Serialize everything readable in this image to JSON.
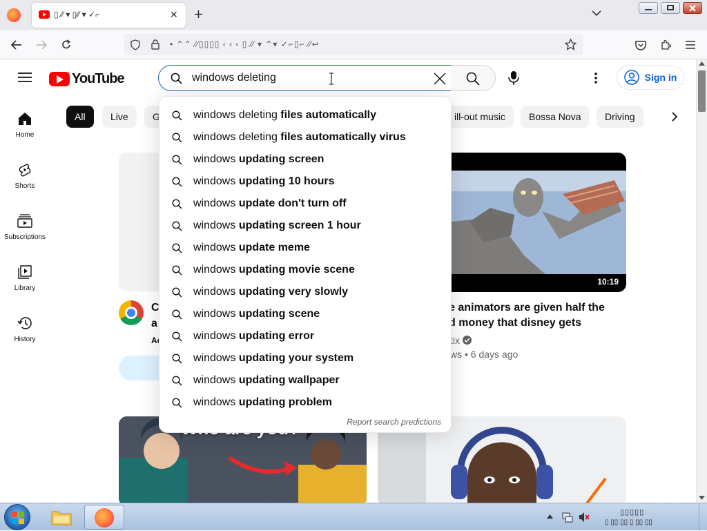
{
  "browser": {
    "tab_title": "▯ ⁄⁄ ▾ ▯⁄⁄ ▾ ✓⌐",
    "tab_close": "✕",
    "new_tab": "+",
    "url_text": "• ⌃⌃ ⁄⁄▯▯▯▯ ‹ ‹ ‹ ▯ ⁄⁄ ▾ ⌃▾ ✓⌐▯⌐ ⁄⁄↩"
  },
  "youtube": {
    "logo_text": "YouTube",
    "search_value": "windows deleting",
    "sign_in_label": "Sign in",
    "chips": [
      "All",
      "Live",
      "G",
      "ill-out music",
      "Bossa Nova",
      "Driving"
    ],
    "sidebar": [
      {
        "label": "Home",
        "icon": "home-icon"
      },
      {
        "label": "Shorts",
        "icon": "shorts-icon"
      },
      {
        "label": "Subscriptions",
        "icon": "subscriptions-icon"
      },
      {
        "label": "Library",
        "icon": "library-icon"
      },
      {
        "label": "History",
        "icon": "history-icon"
      }
    ],
    "suggestions": [
      {
        "prefix": "windows ",
        "plain": "deleting",
        "bold": " files automatically"
      },
      {
        "prefix": "windows ",
        "plain": "deleting",
        "bold": " files automatically virus"
      },
      {
        "prefix": "windows ",
        "plain": "",
        "bold": "updating screen"
      },
      {
        "prefix": "windows ",
        "plain": "",
        "bold": "updating 10 hours"
      },
      {
        "prefix": "windows ",
        "plain": "",
        "bold": "update don't turn off"
      },
      {
        "prefix": "windows ",
        "plain": "",
        "bold": "updating screen 1 hour"
      },
      {
        "prefix": "windows ",
        "plain": "",
        "bold": "update meme"
      },
      {
        "prefix": "windows ",
        "plain": "",
        "bold": "updating movie scene"
      },
      {
        "prefix": "windows ",
        "plain": "",
        "bold": "updating very slowly"
      },
      {
        "prefix": "windows ",
        "plain": "",
        "bold": "updating scene"
      },
      {
        "prefix": "windows ",
        "plain": "",
        "bold": "updating error"
      },
      {
        "prefix": "windows ",
        "plain": "",
        "bold": "updating your system"
      },
      {
        "prefix": "windows ",
        "plain": "",
        "bold": "updating wallpaper"
      },
      {
        "prefix": "windows ",
        "plain": "",
        "bold": "updating problem"
      }
    ],
    "report_label": "Report search predictions",
    "ad": {
      "title_fragment_1": "C",
      "title_fragment_2": "a",
      "sub_fragment": "Ad"
    },
    "video2": {
      "duration": "10:19",
      "title_line1": "e animators are given half the",
      "title_line2": "d money that disney gets",
      "channel_fragment": "tix",
      "meta": "ws • 6 days ago"
    },
    "video3": {
      "overlay_text": "Who are you?"
    }
  },
  "taskbar": {
    "tray_text": "▯▯▯▯▯",
    "tray_text2": "▯ ▯▯ ▯▯ ▯ ▯▯ ▯▯"
  },
  "colors": {
    "yt_red": "#ff0000",
    "accent_blue": "#065fd4",
    "firefox_orange": "#ff7139"
  }
}
